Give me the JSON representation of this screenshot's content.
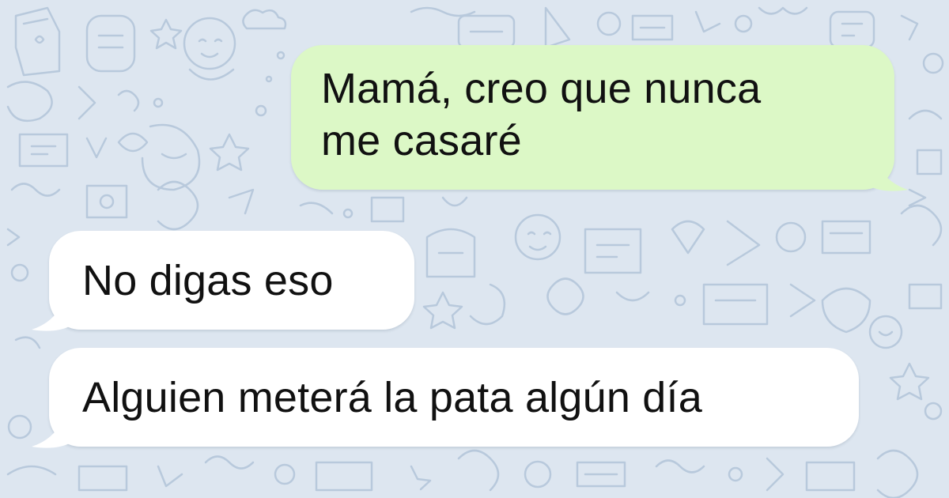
{
  "chat": {
    "background_color": "#dde6f0",
    "doodle_color": "#b8c9dc",
    "messages": [
      {
        "direction": "outgoing",
        "text": "Mamá, creo que nunca\nme casaré",
        "bubble_color": "#dcf8c6"
      },
      {
        "direction": "incoming",
        "text": "No digas eso",
        "bubble_color": "#ffffff"
      },
      {
        "direction": "incoming",
        "text": "Alguien meterá la pata algún día",
        "bubble_color": "#ffffff"
      }
    ]
  }
}
